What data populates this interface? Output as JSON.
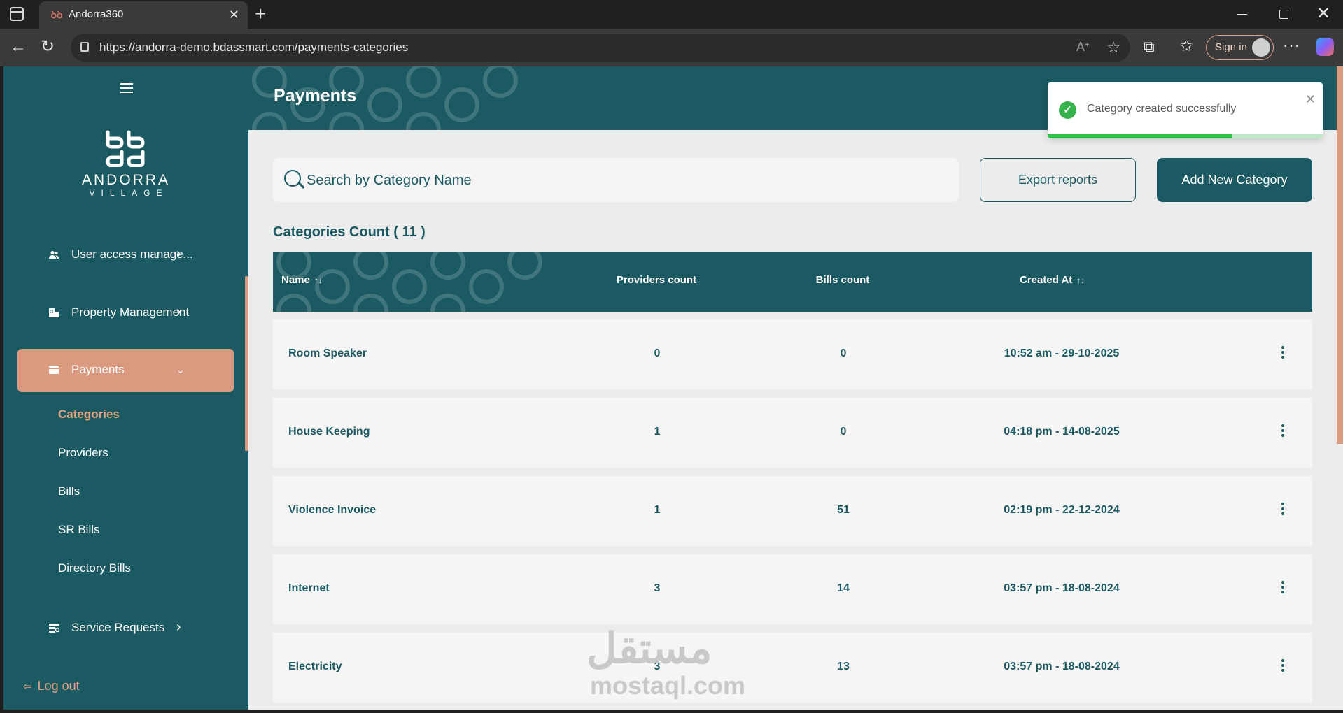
{
  "browser": {
    "tab_title": "Andorra360",
    "url": "https://andorra-demo.bdassmart.com/payments-categories",
    "sign_in_label": "Sign in"
  },
  "sidebar": {
    "logo_name": "ANDORRA",
    "logo_sub": "VILLAGE",
    "nav_items": [
      {
        "label": "User access manage...",
        "icon": "users-icon",
        "expanded": false
      },
      {
        "label": "Property Management",
        "icon": "building-icon",
        "expanded": false
      },
      {
        "label": "Payments",
        "icon": "card-icon",
        "expanded": true
      },
      {
        "label": "Service Requests",
        "icon": "list-icon",
        "expanded": false
      }
    ],
    "sub_items": [
      {
        "label": "Categories",
        "active": true
      },
      {
        "label": "Providers",
        "active": false
      },
      {
        "label": "Bills",
        "active": false
      },
      {
        "label": "SR Bills",
        "active": false
      },
      {
        "label": "Directory Bills",
        "active": false
      }
    ],
    "logout_label": "Log out"
  },
  "header": {
    "title": "Payments"
  },
  "search": {
    "placeholder": "Search by Category Name",
    "value": ""
  },
  "actions": {
    "export_label": "Export reports",
    "add_label": "Add New Category"
  },
  "categories_count_label": "Categories Count ( 11 )",
  "table": {
    "columns": [
      "Name",
      "Providers count",
      "Bills count",
      "Created At"
    ],
    "rows": [
      {
        "name": "Room Speaker",
        "providers": "0",
        "bills": "0",
        "created": "10:52 am - 29-10-2025"
      },
      {
        "name": "House Keeping",
        "providers": "1",
        "bills": "0",
        "created": "04:18 pm - 14-08-2025"
      },
      {
        "name": "Violence Invoice",
        "providers": "1",
        "bills": "51",
        "created": "02:19 pm - 22-12-2024"
      },
      {
        "name": "Internet",
        "providers": "3",
        "bills": "14",
        "created": "03:57 pm - 18-08-2024"
      },
      {
        "name": "Electricity",
        "providers": "3",
        "bills": "13",
        "created": "03:57 pm - 18-08-2024"
      }
    ]
  },
  "toast": {
    "message": "Category created successfully",
    "progress": 0.67
  },
  "watermark": {
    "text": "مستقل",
    "sub": "mostaql.com"
  },
  "colors": {
    "primary": "#1b5a62",
    "accent": "#d99a7f",
    "success": "#36b24a",
    "background": "#ececec"
  }
}
